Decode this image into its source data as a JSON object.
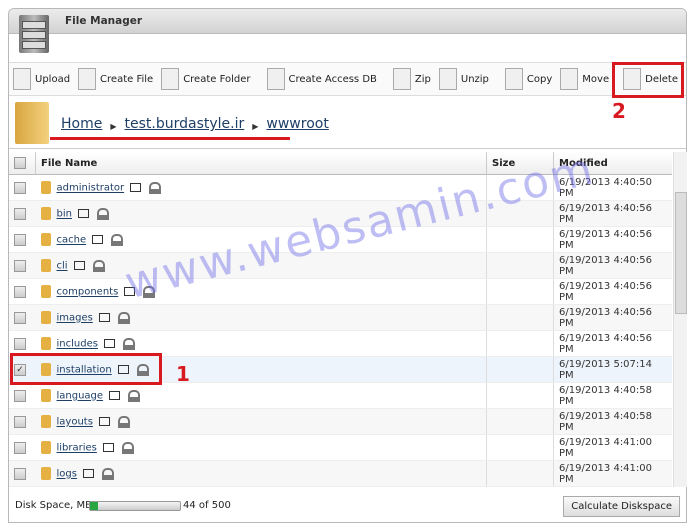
{
  "window": {
    "title": "File Manager"
  },
  "toolbar": [
    {
      "label": "Upload",
      "icon": "upload-icon"
    },
    {
      "label": "Create File",
      "icon": "create-file-icon"
    },
    {
      "label": "Create Folder",
      "icon": "create-folder-icon"
    },
    {
      "label": "Create Access DB",
      "icon": "access-db-icon"
    },
    {
      "label": "Zip",
      "icon": "zip-icon"
    },
    {
      "label": "Unzip",
      "icon": "unzip-icon"
    },
    {
      "label": "Copy",
      "icon": "copy-icon"
    },
    {
      "label": "Move",
      "icon": "move-icon"
    },
    {
      "label": "Delete",
      "icon": "delete-icon"
    }
  ],
  "breadcrumb": [
    "Home",
    "test.burdastyle.ir",
    "wwwroot"
  ],
  "table": {
    "headers": [
      "File Name",
      "Size",
      "Modified"
    ],
    "rows": [
      {
        "name": "administrator",
        "modified": "6/19/2013 4:40:50 PM",
        "checked": false
      },
      {
        "name": "bin",
        "modified": "6/19/2013 4:40:56 PM",
        "checked": false
      },
      {
        "name": "cache",
        "modified": "6/19/2013 4:40:56 PM",
        "checked": false
      },
      {
        "name": "cli",
        "modified": "6/19/2013 4:40:56 PM",
        "checked": false
      },
      {
        "name": "components",
        "modified": "6/19/2013 4:40:56 PM",
        "checked": false
      },
      {
        "name": "images",
        "modified": "6/19/2013 4:40:56 PM",
        "checked": false
      },
      {
        "name": "includes",
        "modified": "6/19/2013 4:40:56 PM",
        "checked": false
      },
      {
        "name": "installation",
        "modified": "6/19/2013 5:07:14 PM",
        "checked": true
      },
      {
        "name": "language",
        "modified": "6/19/2013 4:40:58 PM",
        "checked": false
      },
      {
        "name": "layouts",
        "modified": "6/19/2013 4:40:58 PM",
        "checked": false
      },
      {
        "name": "libraries",
        "modified": "6/19/2013 4:41:00 PM",
        "checked": false
      },
      {
        "name": "logs",
        "modified": "6/19/2013 4:41:00 PM",
        "checked": false
      }
    ]
  },
  "footer": {
    "disk_label": "Disk Space, MB:",
    "disk_used": 44,
    "disk_total": 500,
    "disk_text": "44 of 500",
    "calc_button": "Calculate Diskspace"
  },
  "annotations": {
    "step1": "1",
    "step2": "2",
    "color": "#d8191f"
  },
  "watermark": "www.websamin.com"
}
